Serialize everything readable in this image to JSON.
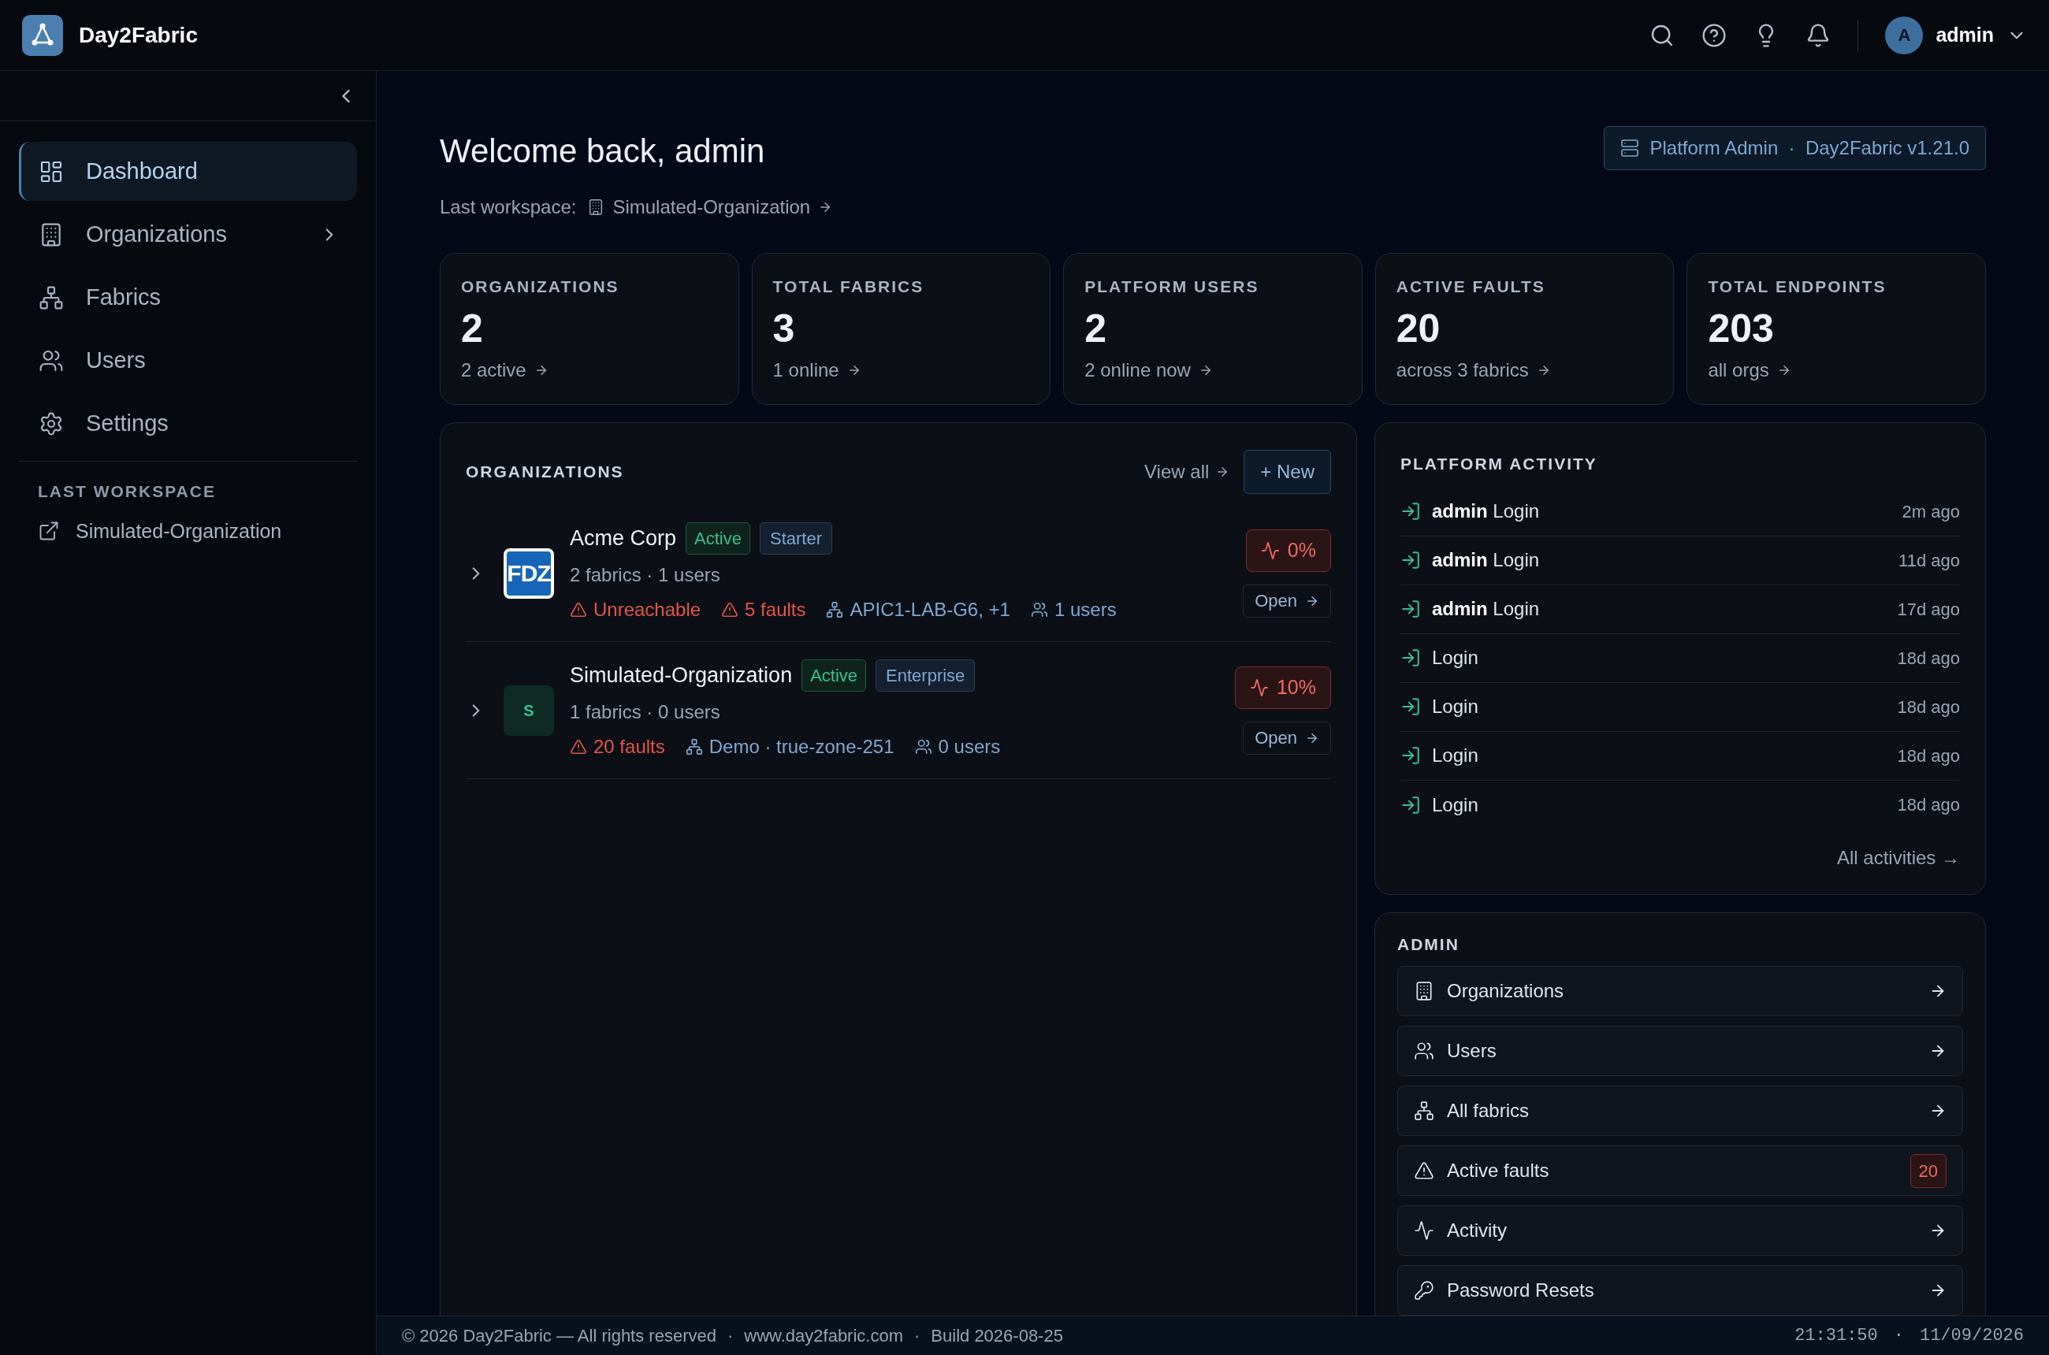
{
  "header": {
    "app_name": "Day2Fabric",
    "avatar_initial": "A",
    "user_name": "admin"
  },
  "sidebar": {
    "items": [
      {
        "label": "Dashboard",
        "selected": true,
        "expandable": false
      },
      {
        "label": "Organizations",
        "selected": false,
        "expandable": true
      },
      {
        "label": "Fabrics",
        "selected": false,
        "expandable": false
      },
      {
        "label": "Users",
        "selected": false,
        "expandable": false
      },
      {
        "label": "Settings",
        "selected": false,
        "expandable": false
      }
    ],
    "section_title": "LAST WORKSPACE",
    "workspace_link": "Simulated-Organization"
  },
  "page": {
    "title": "Welcome back, admin",
    "last_workspace_label": "Last workspace:",
    "last_workspace": "Simulated-Organization",
    "platform_badge": "Platform Admin  ·  Day2Fabric v1.21.0"
  },
  "stats": [
    {
      "label": "ORGANIZATIONS",
      "value": "2",
      "sub": "2 active"
    },
    {
      "label": "TOTAL FABRICS",
      "value": "3",
      "sub": "1 online"
    },
    {
      "label": "PLATFORM USERS",
      "value": "2",
      "sub": "2 online now"
    },
    {
      "label": "ACTIVE FAULTS",
      "value": "20",
      "sub": "across 3 fabrics"
    },
    {
      "label": "TOTAL ENDPOINTS",
      "value": "203",
      "sub": "all orgs"
    }
  ],
  "organizations": {
    "title": "ORGANIZATIONS",
    "view_all": "View all",
    "new_button": "+ New",
    "rows": [
      {
        "name": "Acme Corp",
        "expanded": false,
        "logo": {
          "kind": "brand",
          "text": "FDZ"
        },
        "tags": [
          {
            "label": "Active",
            "kind": "status"
          },
          {
            "label": "Starter",
            "kind": "plan"
          }
        ],
        "summary": "2 fabrics · 1 users",
        "meta": [
          {
            "kind": "warning",
            "text": "Unreachable"
          },
          {
            "kind": "warning",
            "text": "5 faults"
          },
          {
            "kind": "fabric",
            "text": "APIC1-LAB-G6, +1"
          },
          {
            "kind": "users",
            "text": "1 users"
          }
        ],
        "health": "0%",
        "open": "Open"
      },
      {
        "name": "Simulated-Organization",
        "expanded": false,
        "logo": {
          "kind": "initial",
          "text": "S"
        },
        "tags": [
          {
            "label": "Active",
            "kind": "status"
          },
          {
            "label": "Enterprise",
            "kind": "plan"
          }
        ],
        "summary": "1 fabrics · 0 users",
        "meta": [
          {
            "kind": "warning",
            "text": "20 faults"
          },
          {
            "kind": "fabric",
            "text": "Demo · true-zone-251"
          },
          {
            "kind": "users",
            "text": "0 users"
          }
        ],
        "health": "10%",
        "open": "Open"
      }
    ]
  },
  "activity": {
    "title": "PLATFORM ACTIVITY",
    "items": [
      {
        "text": "**admin** Login",
        "time": "2m ago"
      },
      {
        "text": "**admin** Login",
        "time": "11d ago"
      },
      {
        "text": "**admin** Login",
        "time": "17d ago"
      },
      {
        "text": "Login",
        "time": "18d ago"
      },
      {
        "text": "Login",
        "time": "18d ago"
      },
      {
        "text": "Login",
        "time": "18d ago"
      },
      {
        "text": "Login",
        "time": "18d ago"
      }
    ],
    "all_link": "All activities →"
  },
  "admin": {
    "title": "ADMIN",
    "items": [
      {
        "label": "Organizations"
      },
      {
        "label": "Users"
      },
      {
        "label": "All fabrics"
      },
      {
        "label": "Active faults",
        "badge": "20"
      },
      {
        "label": "Activity"
      },
      {
        "label": "Password Resets"
      }
    ]
  },
  "footer": {
    "separator": "·",
    "left": [
      "© 2026 Day2Fabric — All rights reserved",
      "www.day2fabric.com",
      "Build 2026-08-25"
    ],
    "time": "21:31:50",
    "date": "11/09/2026"
  }
}
